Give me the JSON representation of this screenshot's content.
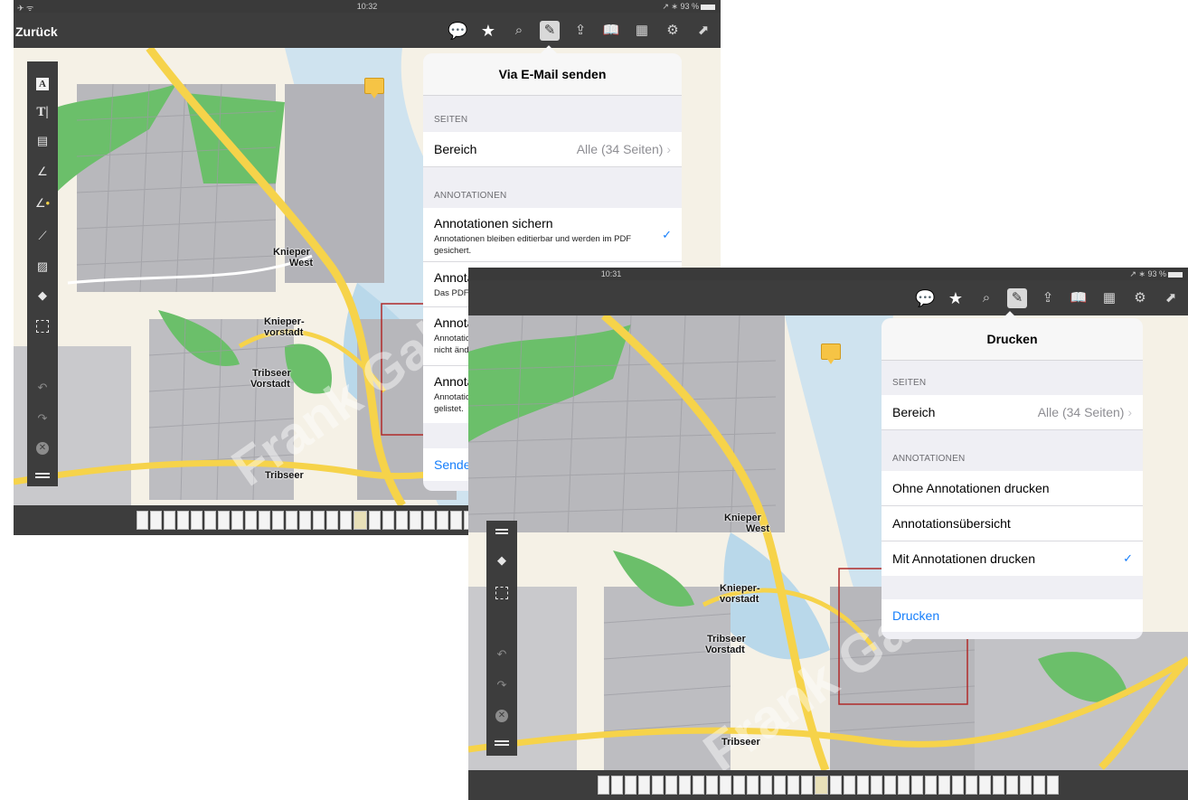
{
  "status_front": {
    "left": "✈ ᯤ",
    "time": "10:32",
    "right": "↗ ∗ 93 %"
  },
  "status_back": {
    "left": "",
    "time": "10:31",
    "right": "↗ ∗ 93 %"
  },
  "nav": {
    "back_label": "Zurück"
  },
  "map_labels": {
    "knieper_west_1": "Knieper",
    "knieper_west_2": "West",
    "knieper_vorstadt_1": "Knieper-",
    "knieper_vorstadt_2": "vorstadt",
    "tribseer_vorstadt_1": "Tribseer",
    "tribseer_vorstadt_2": "Vorstadt",
    "tribseer": "Tribseer"
  },
  "email_popover": {
    "title": "Via E-Mail senden",
    "pages_header": "SEITEN",
    "range_label": "Bereich",
    "range_value": "Alle (34 Seiten)",
    "annotations_header": "ANNOTATIONEN",
    "options": [
      {
        "title": "Annotationen sichern",
        "subtitle": "Annotationen bleiben editierbar und werden im PDF gesichert.",
        "checked": true
      },
      {
        "title": "Annotationen ignorieren",
        "subtitle": "Das PDF wird keine Annotationen enthalten.",
        "checked": false
      },
      {
        "title": "Annotationen zeichnen",
        "subtitle": "Annotationen werden in das PDF gezeichnet und sind nicht änderbar.",
        "checked": false
      },
      {
        "title": "Annotationsübersicht",
        "subtitle": "Annotationen werden im PDF gesichert und in der E-Mail gelistet.",
        "checked": false
      }
    ],
    "action": "Senden"
  },
  "print_popover": {
    "title": "Drucken",
    "pages_header": "SEITEN",
    "range_label": "Bereich",
    "range_value": "Alle (34 Seiten)",
    "annotations_header": "ANNOTATIONEN",
    "options": [
      {
        "title": "Ohne Annotationen drucken",
        "checked": false
      },
      {
        "title": "Annotationsübersicht",
        "checked": false
      },
      {
        "title": "Mit Annotationen drucken",
        "checked": true
      }
    ],
    "action": "Drucken"
  },
  "icons": {
    "check": "✓",
    "chevron": "›",
    "comments": "💬",
    "star": "★",
    "search": "⌕",
    "edit": "✎",
    "share": "⇪",
    "book": "📖",
    "grid": "▦",
    "gear": "⚙",
    "export": "⬈"
  },
  "colors": {
    "accent": "#157efb",
    "toolbar": "#3d3d3d",
    "water": "#cfe3ef",
    "park": "#6bbf6a",
    "road": "#f6d34a"
  }
}
